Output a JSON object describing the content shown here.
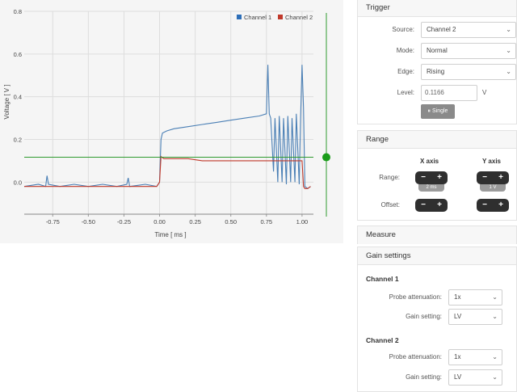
{
  "chart_data": {
    "type": "line",
    "xlabel": "Time [ ms ]",
    "ylabel": "Voltage [ V ]",
    "xlim": [
      -0.95,
      1.08
    ],
    "ylim": [
      -0.15,
      0.8
    ],
    "x_ticks": [
      "-0.75",
      "-0.50",
      "-0.25",
      "0.00",
      "0.25",
      "0.50",
      "0.75",
      "1.00"
    ],
    "y_ticks": [
      "0.0",
      "0.2",
      "0.4",
      "0.6",
      "0.8"
    ],
    "grid": true,
    "legend_position": "top-right",
    "trigger_level": 0.1166,
    "series": [
      {
        "name": "Channel 1",
        "color": "#4a7fb5",
        "x": [
          -0.95,
          -0.85,
          -0.8,
          -0.79,
          -0.78,
          -0.7,
          -0.6,
          -0.5,
          -0.4,
          -0.3,
          -0.23,
          -0.22,
          -0.21,
          -0.1,
          -0.02,
          0.0,
          0.01,
          0.02,
          0.05,
          0.1,
          0.2,
          0.3,
          0.4,
          0.5,
          0.6,
          0.7,
          0.75,
          0.76,
          0.77,
          0.78,
          0.8,
          0.81,
          0.83,
          0.84,
          0.86,
          0.87,
          0.89,
          0.9,
          0.92,
          0.93,
          0.95,
          0.96,
          0.98,
          0.99,
          1.0,
          1.01,
          1.02,
          1.04,
          1.06
        ],
        "y": [
          -0.02,
          -0.01,
          -0.02,
          0.03,
          -0.01,
          -0.02,
          -0.01,
          -0.02,
          -0.01,
          -0.02,
          -0.01,
          0.02,
          -0.02,
          -0.01,
          -0.02,
          0.0,
          0.2,
          0.23,
          0.24,
          0.25,
          0.26,
          0.27,
          0.28,
          0.29,
          0.3,
          0.31,
          0.32,
          0.55,
          0.32,
          0.3,
          0.05,
          0.3,
          0.0,
          0.31,
          0.0,
          0.3,
          -0.01,
          0.31,
          0.0,
          0.3,
          0.0,
          0.32,
          -0.01,
          0.3,
          0.55,
          0.35,
          -0.02,
          -0.03,
          -0.02
        ]
      },
      {
        "name": "Channel 2",
        "color": "#c0392b",
        "x": [
          -0.95,
          -0.8,
          -0.6,
          -0.4,
          -0.2,
          -0.02,
          0.0,
          0.01,
          0.03,
          0.1,
          0.2,
          0.3,
          0.4,
          0.5,
          0.6,
          0.7,
          0.8,
          0.9,
          1.0,
          1.01,
          1.02,
          1.04,
          1.06
        ],
        "y": [
          -0.02,
          -0.02,
          -0.02,
          -0.02,
          -0.02,
          -0.02,
          0.0,
          0.12,
          0.11,
          0.11,
          0.11,
          0.1,
          0.1,
          0.1,
          0.1,
          0.1,
          0.1,
          0.1,
          0.1,
          -0.02,
          -0.03,
          -0.03,
          -0.02
        ]
      }
    ]
  },
  "trigger": {
    "title": "Trigger",
    "source_label": "Source:",
    "source_value": "Channel 2",
    "mode_label": "Mode:",
    "mode_value": "Normal",
    "edge_label": "Edge:",
    "edge_value": "Rising",
    "level_label": "Level:",
    "level_value": "0.1166",
    "level_unit": "V",
    "single_label": "⏸ Single"
  },
  "range": {
    "title": "Range",
    "x_axis_label": "X axis",
    "y_axis_label": "Y axis",
    "range_label": "Range:",
    "offset_label": "Offset:",
    "x_scale": "2 ms",
    "y_scale": "1 V",
    "minus": "−",
    "plus": "+"
  },
  "measure": {
    "title": "Measure"
  },
  "gain": {
    "title": "Gain settings",
    "channel1": {
      "title": "Channel 1",
      "probe_label": "Probe attenuation:",
      "probe_value": "1x",
      "gain_label": "Gain setting:",
      "gain_value": "LV"
    },
    "channel2": {
      "title": "Channel 2",
      "probe_label": "Probe attenuation:",
      "probe_value": "1x",
      "gain_label": "Gain setting:",
      "gain_value": "LV"
    }
  },
  "icons": {
    "dropdown": "chevron-down-icon",
    "trigger_handle": "trigger-level-handle"
  },
  "colors": {
    "trigger_line": "#2e9a2e",
    "handle": "#1a9c1a"
  }
}
